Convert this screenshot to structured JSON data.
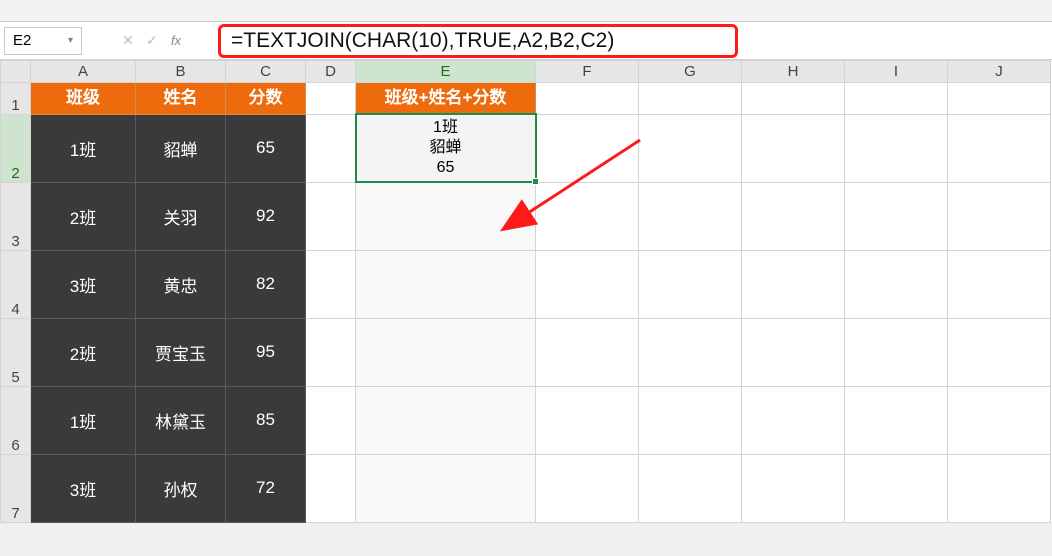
{
  "name_box": "E2",
  "formula": "=TEXTJOIN(CHAR(10),TRUE,A2,B2,C2)",
  "col_headers": [
    "A",
    "B",
    "C",
    "D",
    "E",
    "F",
    "G",
    "H",
    "I",
    "J"
  ],
  "row_headers": [
    "1",
    "2",
    "3",
    "4",
    "5",
    "6",
    "7"
  ],
  "active_col": "E",
  "active_row": "2",
  "header_row": {
    "A": "班级",
    "B": "姓名",
    "C": "分数",
    "E": "班级+姓名+分数"
  },
  "data_rows": [
    {
      "A": "1班",
      "B": "貂蝉",
      "C": "65",
      "E": "1班\n貂蝉\n65",
      "E_selected": true
    },
    {
      "A": "2班",
      "B": "关羽",
      "C": "92",
      "E": ""
    },
    {
      "A": "3班",
      "B": "黄忠",
      "C": "82",
      "E": ""
    },
    {
      "A": "2班",
      "B": "贾宝玉",
      "C": "95",
      "E": ""
    },
    {
      "A": "1班",
      "B": "林黛玉",
      "C": "85",
      "E": ""
    },
    {
      "A": "3班",
      "B": "孙权",
      "C": "72",
      "E": ""
    }
  ],
  "fb_icons": {
    "cancel": "✕",
    "enter": "✓",
    "fx": "fx"
  }
}
